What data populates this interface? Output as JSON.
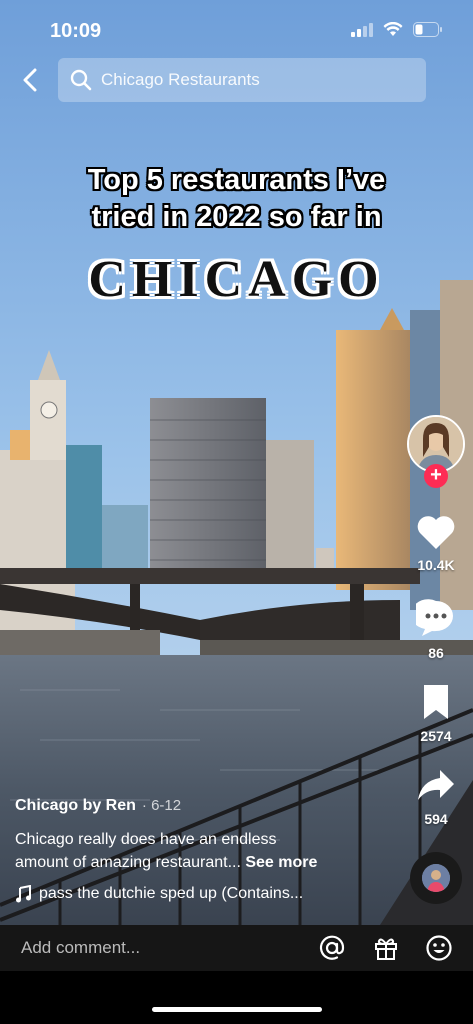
{
  "status_bar": {
    "time": "10:09"
  },
  "search": {
    "query": "Chicago Restaurants"
  },
  "overlay": {
    "line1": "Top 5 restaurants I’ve",
    "line2": "tried in 2022 so far in",
    "city": "CHICAGO"
  },
  "actions": {
    "likes": "10.4K",
    "comments": "86",
    "saves": "2574",
    "shares": "594"
  },
  "post": {
    "author": "Chicago by Ren",
    "date": "· 6-12",
    "caption_line1": "Chicago really does have an endless",
    "caption_line2": "amount of amazing restaurant...",
    "see_more": "See more",
    "sound": "pass the dutchie sped up (Contains..."
  },
  "comment_bar": {
    "placeholder": "Add comment..."
  },
  "colors": {
    "follow": "#fe2c55",
    "comment_bar": "#161616"
  },
  "icons": [
    "back-icon",
    "search-icon",
    "heart-icon",
    "comment-icon",
    "bookmark-icon",
    "share-icon",
    "music-note-icon",
    "mention-icon",
    "gift-icon",
    "emoji-icon"
  ]
}
